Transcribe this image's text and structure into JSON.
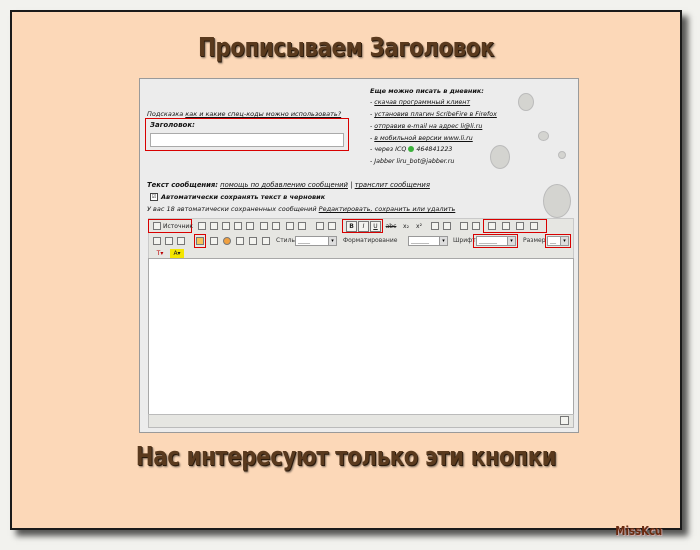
{
  "headings": {
    "top": "Прописываем Заголовок",
    "bottom": "Нас интересуют только эти кнопки"
  },
  "signature": "MissKcu",
  "form": {
    "hint_prefix": "Подсказка",
    "hint_link": "как и какие спец-коды можно использовать?",
    "title_label": "Заголовок:",
    "message_label": "Текст сообщения:",
    "message_help_link": "помощь по добавлению сообщений",
    "separator": "|",
    "translit_link": "транслит сообщения",
    "autosave_label": "Автоматически сохранять текст в черновик",
    "autosave_checked": "☑",
    "saved_count_text": "У вас 18 автоматически сохраненных сообщений",
    "saved_actions_link": "Редактировать, сохранить или удалить"
  },
  "info_panel": {
    "title": "Еще можно писать в дневник:",
    "items": [
      {
        "prefix": "- ",
        "link": "скачав программный клиент",
        "suffix": ""
      },
      {
        "prefix": "- ",
        "link": "установив плагин ScribeFire в Firefox",
        "suffix": ""
      },
      {
        "prefix": "- ",
        "link": "отправив e-mail на адрес li@li.ru",
        "suffix": ""
      },
      {
        "prefix": "- ",
        "link": "в мобильной версии www.li.ru",
        "suffix": ""
      },
      {
        "prefix": "- через ICQ ",
        "link": "",
        "suffix": "464841223"
      },
      {
        "prefix": "- Jabber ",
        "link": "",
        "suffix": "liru_bot@jabber.ru"
      }
    ]
  },
  "toolbar": {
    "source_label": "Источник",
    "bold": "B",
    "italic": "I",
    "underline": "U",
    "strike": "abc",
    "subscript": "x₂",
    "superscript": "x²",
    "style_label": "Стиль",
    "format_label": "Форматирование",
    "font_label": "Шрифт",
    "size_label": "Размер",
    "style_value": "____",
    "format_value": "______",
    "font_value": "______",
    "size_value": "__",
    "text_color_label": "T",
    "bg_color_label": "A",
    "dropdown_arrow": "▾"
  },
  "colors": {
    "card_bg": "#fcd8b8",
    "heading": "#5a3a1e",
    "highlight": "#d80000",
    "icq_dot": "#3bb13b"
  }
}
